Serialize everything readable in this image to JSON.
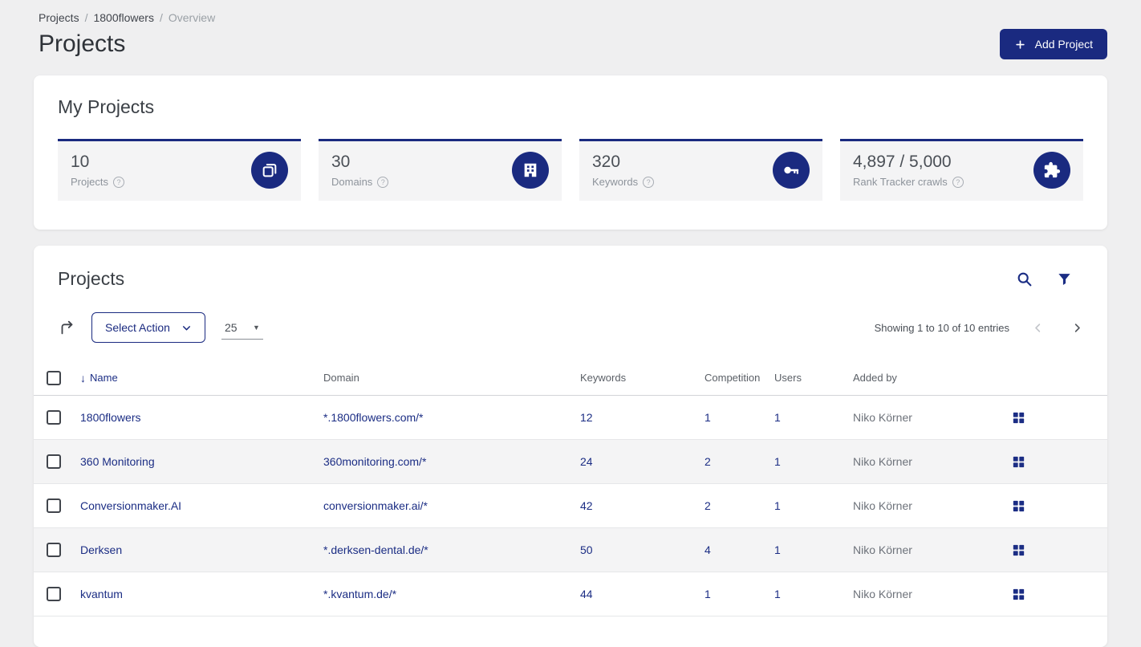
{
  "colors": {
    "accent": "#1a2a80",
    "link": "#1b2d84",
    "page_bg": "#efeff0",
    "tile_bg": "#f4f4f5"
  },
  "breadcrumb": {
    "items": [
      "Projects",
      "1800flowers",
      "Overview"
    ],
    "sep": "/"
  },
  "header": {
    "title": "Projects",
    "add_button_label": "Add Project"
  },
  "stats": {
    "title": "My Projects",
    "tiles": [
      {
        "value": "10",
        "label": "Projects",
        "icon": "projects-copy-icon"
      },
      {
        "value": "30",
        "label": "Domains",
        "icon": "building-icon"
      },
      {
        "value": "320",
        "label": "Keywords",
        "icon": "key-icon"
      },
      {
        "value": "4,897 / 5,000",
        "label": "Rank Tracker crawls",
        "icon": "puzzle-icon"
      }
    ],
    "help_glyph": "?"
  },
  "panel": {
    "title": "Projects",
    "icons": [
      "search-icon",
      "filter-icon"
    ]
  },
  "toolbar": {
    "export_icon": "export-arrow-icon",
    "select_action_label": "Select Action",
    "page_size": "25",
    "showing_text": "Showing 1 to 10 of 10 entries"
  },
  "table": {
    "columns": [
      "Name",
      "Domain",
      "Keywords",
      "Competition",
      "Users",
      "Added by"
    ],
    "sorted_column": "Name",
    "rows": [
      {
        "name": "1800flowers",
        "domain": "*.1800flowers.com/*",
        "keywords": "12",
        "competition": "1",
        "users": "1",
        "added_by": "Niko Körner"
      },
      {
        "name": "360 Monitoring",
        "domain": "360monitoring.com/*",
        "keywords": "24",
        "competition": "2",
        "users": "1",
        "added_by": "Niko Körner"
      },
      {
        "name": "Conversionmaker.AI",
        "domain": "conversionmaker.ai/*",
        "keywords": "42",
        "competition": "2",
        "users": "1",
        "added_by": "Niko Körner"
      },
      {
        "name": "Derksen",
        "domain": "*.derksen-dental.de/*",
        "keywords": "50",
        "competition": "4",
        "users": "1",
        "added_by": "Niko Körner"
      },
      {
        "name": "kvantum",
        "domain": "*.kvantum.de/*",
        "keywords": "44",
        "competition": "1",
        "users": "1",
        "added_by": "Niko Körner"
      }
    ]
  }
}
